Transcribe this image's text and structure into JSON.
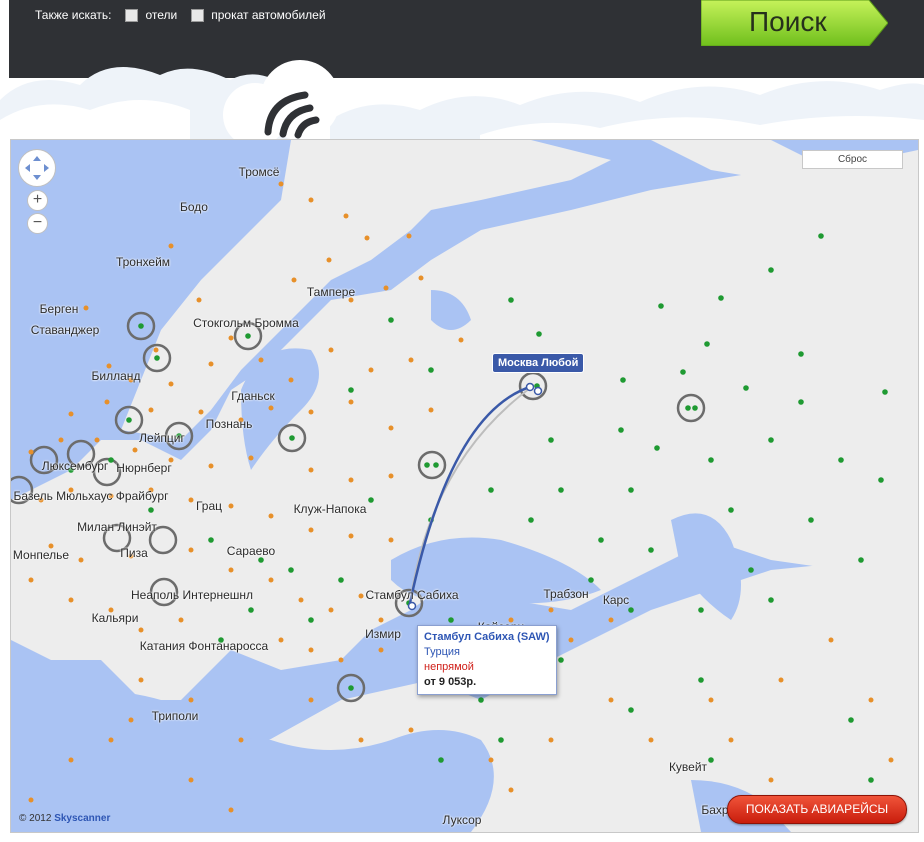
{
  "search_also": {
    "label": "Также искать:",
    "options": [
      {
        "label": "отели",
        "checked": false
      },
      {
        "label": "прокат автомобилей",
        "checked": false
      }
    ]
  },
  "search_button": "Поиск",
  "map": {
    "reset_label": "Сброс",
    "zoom_in": "+",
    "zoom_out": "−",
    "cities": [
      "Тромсё",
      "Бодо",
      "Тронхейм",
      "Берген",
      "Ставанджер",
      "Тампере",
      "Стокгольм Бромма",
      "Билланд",
      "Гданьск",
      "Познань",
      "Лейпциг",
      "Люксембург",
      "Нюрнберг",
      "Базель Мюльхаус Фрайбург",
      "Грац",
      "Милан Линэйт",
      "Пиза",
      "Монпелье",
      "Клуж-Напока",
      "Сараево",
      "Неаполь Интернешнл",
      "Кальяри",
      "Катания Фонтанаросса",
      "Триполи",
      "Измир",
      "Стамбул Сабиха",
      "Трабзон",
      "Карс",
      "Кайсери",
      "Кувейт",
      "Бахр",
      "Луксор"
    ],
    "origin_label": "Москва Любой",
    "popup": {
      "title": "Стамбул Сабиха (SAW)",
      "country": "Турция",
      "stops": "непрямой",
      "price": "от 9 053р."
    },
    "colors": {
      "direct": "#1f9a32",
      "indirect": "#e7902a",
      "route": "#3a59a8",
      "water": "#aac3f3",
      "land": "#ededed"
    }
  },
  "copyright": {
    "prefix": "© 2012",
    "brand": "Skyscanner"
  },
  "show_flights_button": "ПОКАЗАТЬ АВИАРЕЙСЫ"
}
